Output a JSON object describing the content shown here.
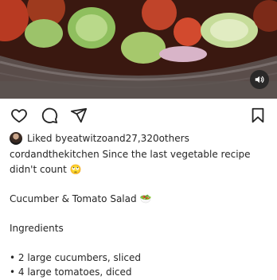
{
  "post": {
    "mute_icon": "volume-icon",
    "actions": {
      "like_icon": "heart-icon",
      "comment_icon": "comment-icon",
      "share_icon": "send-icon",
      "save_icon": "bookmark-icon"
    },
    "likes": {
      "prefix": "Liked by ",
      "user": "eatwitzo",
      "middle": " and ",
      "count": "27,320",
      "suffix": " others"
    },
    "caption": {
      "username": "cordandthekitchen",
      "text_line1": " Since the last vegetable recipe",
      "text_line2": "didn't count ",
      "emoji1": "🙄",
      "recipe_title": "Cucumber & Tomato Salad ",
      "emoji2": "🥗",
      "ingredients_heading": "Ingredients",
      "ingredients": [
        "• 2 large cucumbers, sliced",
        "• 4 large tomatoes, diced"
      ]
    }
  }
}
